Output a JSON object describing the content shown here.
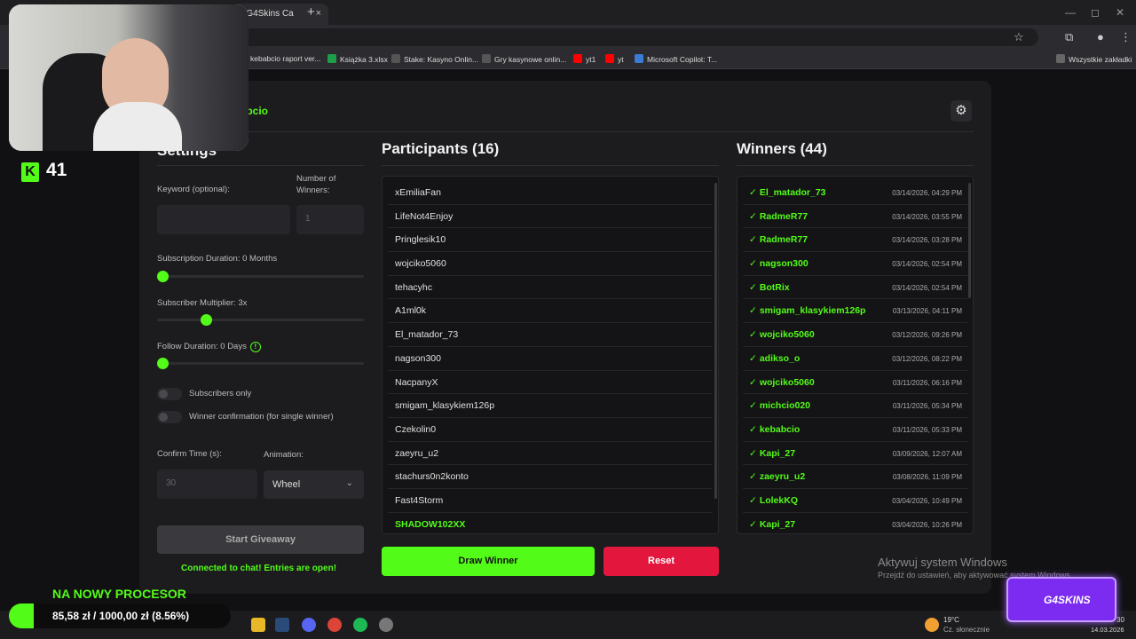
{
  "browser": {
    "tab_title": "| G4Skins Ca",
    "tab_close": "×",
    "new_tab": "+",
    "bookmarks": [
      {
        "label": "kebabcio raport ver...",
        "color": "#888888"
      },
      {
        "label": "Książka 3.xlsx",
        "color": "#1e9e4a"
      },
      {
        "label": "Stake: Kasyno Onlin...",
        "color": "#cccccc"
      },
      {
        "label": "Gry kasynowe onlin...",
        "color": "#cccccc"
      },
      {
        "label": "yt1",
        "color": "#ff0000"
      },
      {
        "label": "yt",
        "color": "#ff0000"
      },
      {
        "label": "Microsoft Copilot: T...",
        "color": "#3a7bd5"
      }
    ],
    "all_bookmarks": "Wszystkie zakładki"
  },
  "app": {
    "brand": "ubcio",
    "settings_heading": "Settings",
    "keyword_label": "Keyword (optional):",
    "keyword_value": "",
    "winners_count_label": "Number of Winners:",
    "winners_count_placeholder": "1",
    "sub_duration_label": "Subscription Duration: 0 Months",
    "sub_duration_value": 0,
    "multiplier_label": "Subscriber Multiplier: 3x",
    "multiplier_value": 0.24,
    "follow_label": "Follow Duration:  0  Days",
    "follow_value": 0,
    "info_icon": "!",
    "subscribers_only": "Subscribers only",
    "winner_confirmation": "Winner confirmation (for single winner)",
    "confirm_time_label": "Confirm Time (s):",
    "confirm_time_placeholder": "30",
    "animation_label": "Animation:",
    "animation_value": "Wheel",
    "start_button": "Start Giveaway",
    "status": "Connected to chat! Entries are open!",
    "participants_heading": "Participants (16)",
    "participants": [
      "xEmiliaFan",
      "LifeNot4Enjoy",
      "Pringlesik10",
      "wojciko5060",
      "tehacyhc",
      "A1ml0k",
      "El_matador_73",
      "nagson300",
      "NacpanyX",
      "smigam_klasykiem126p",
      "Czekolin0",
      "zaeyru_u2",
      "stachurs0n2konto",
      "Fast4Storm",
      "SHADOW102XX"
    ],
    "highlighted_participant": "SHADOW102XX",
    "winners_heading": "Winners (44)",
    "winners": [
      {
        "name": "El_matador_73",
        "date": "03/14/2026, 04:29 PM"
      },
      {
        "name": "RadmeR77",
        "date": "03/14/2026, 03:55 PM"
      },
      {
        "name": "RadmeR77",
        "date": "03/14/2026, 03:28 PM"
      },
      {
        "name": "nagson300",
        "date": "03/14/2026, 02:54 PM"
      },
      {
        "name": "BotRix",
        "date": "03/14/2026, 02:54 PM"
      },
      {
        "name": "smigam_klasykiem126p",
        "date": "03/13/2026, 04:11 PM"
      },
      {
        "name": "wojciko5060",
        "date": "03/12/2026, 09:26 PM"
      },
      {
        "name": "adikso_o",
        "date": "03/12/2026, 08:22 PM"
      },
      {
        "name": "wojciko5060",
        "date": "03/11/2026, 06:16 PM"
      },
      {
        "name": "michcio020",
        "date": "03/11/2026, 05:34 PM"
      },
      {
        "name": "kebabcio",
        "date": "03/11/2026, 05:33 PM"
      },
      {
        "name": "Kapi_27",
        "date": "03/09/2026, 12:07 AM"
      },
      {
        "name": "zaeyru_u2",
        "date": "03/08/2026, 11:09 PM"
      },
      {
        "name": "LolekKQ",
        "date": "03/04/2026, 10:49 PM"
      },
      {
        "name": "Kapi_27",
        "date": "03/04/2026, 10:26 PM"
      }
    ],
    "check": "✓",
    "draw_button": "Draw Winner",
    "reset_button": "Reset",
    "accent": "#53fc18",
    "reset_color": "#e3173e"
  },
  "windows": {
    "activate_title": "Aktywuj system Windows",
    "activate_sub": "Przejdź do ustawień, aby aktywować system Windows.",
    "weather_temp": "19°C",
    "weather_desc": "Cz. słonecznie",
    "time": "30",
    "date": "14.03.2026"
  },
  "overlay": {
    "kick_count": "41",
    "goal_title": "NA NOWY PROCESOR",
    "goal_text": "85,58 zł / 1000,00 zł (8.56%)",
    "goal_fraction": 0.0856,
    "sponsor": "G4SKINS"
  }
}
